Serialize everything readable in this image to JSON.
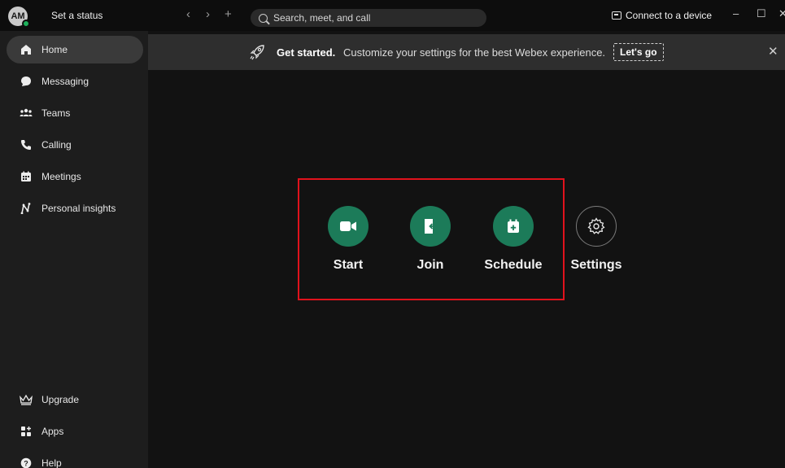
{
  "topbar": {
    "avatar_initials": "AM",
    "status_text": "Set a status",
    "back_label": "‹",
    "forward_label": "›",
    "add_label": "+",
    "search_placeholder": "Search, meet, and call",
    "connect_label": "Connect to a device",
    "minimize_label": "–",
    "maximize_label": "☐",
    "close_label": "✕"
  },
  "sidebar": {
    "items": [
      {
        "label": "Home",
        "icon": "home-icon",
        "active": true
      },
      {
        "label": "Messaging",
        "icon": "chat-bubble-icon"
      },
      {
        "label": "Teams",
        "icon": "people-icon"
      },
      {
        "label": "Calling",
        "icon": "phone-icon"
      },
      {
        "label": "Meetings",
        "icon": "calendar-icon"
      },
      {
        "label": "Personal insights",
        "icon": "insights-icon"
      }
    ],
    "bottom_items": [
      {
        "label": "Upgrade",
        "icon": "crown-icon"
      },
      {
        "label": "Apps",
        "icon": "apps-icon"
      },
      {
        "label": "Help",
        "icon": "help-icon"
      }
    ]
  },
  "banner": {
    "title": "Get started.",
    "text": "Customize your settings for the best Webex experience.",
    "button_label": "Let's go",
    "close_label": "✕"
  },
  "actions": [
    {
      "label": "Start",
      "icon": "video-camera-icon"
    },
    {
      "label": "Join",
      "icon": "join-meeting-icon"
    },
    {
      "label": "Schedule",
      "icon": "calendar-add-icon"
    },
    {
      "label": "Settings",
      "icon": "gear-icon"
    }
  ],
  "colors": {
    "accent_green": "#1c7b59",
    "highlight_red": "#e0121c",
    "presence_green": "#1db15b"
  }
}
